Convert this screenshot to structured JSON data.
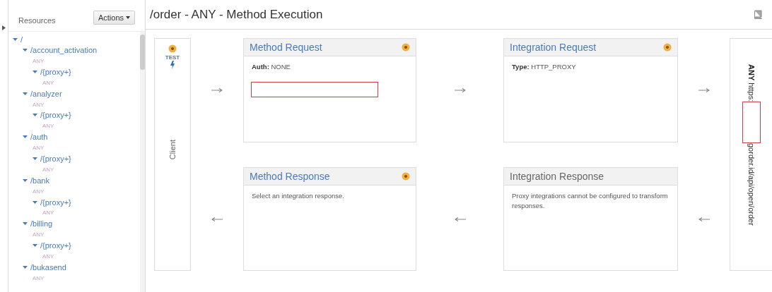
{
  "sidebar": {
    "title": "Resources",
    "actions_button": "Actions",
    "collapsed": false,
    "tree": [
      {
        "label": "/",
        "expanded": true,
        "children": [
          {
            "label": "/account_activation",
            "expanded": true,
            "methods": [
              "ANY"
            ],
            "children": [
              {
                "label": "/{proxy+}",
                "expanded": true,
                "methods": [
                  "ANY"
                ]
              }
            ]
          },
          {
            "label": "/analyzer",
            "expanded": true,
            "methods": [
              "ANY"
            ],
            "children": [
              {
                "label": "/{proxy+}",
                "expanded": true,
                "methods": [
                  "ANY"
                ]
              }
            ]
          },
          {
            "label": "/auth",
            "expanded": true,
            "methods": [
              "ANY"
            ],
            "children": [
              {
                "label": "/{proxy+}",
                "expanded": true,
                "methods": [
                  "ANY"
                ]
              }
            ]
          },
          {
            "label": "/bank",
            "expanded": true,
            "methods": [
              "ANY"
            ],
            "children": [
              {
                "label": "/{proxy+}",
                "expanded": true,
                "methods": [
                  "ANY"
                ]
              }
            ]
          },
          {
            "label": "/billing",
            "expanded": true,
            "methods": [
              "ANY"
            ],
            "children": [
              {
                "label": "/{proxy+}",
                "expanded": true,
                "methods": [
                  "ANY"
                ]
              }
            ]
          },
          {
            "label": "/bukasend",
            "expanded": true,
            "methods": [
              "ANY"
            ]
          }
        ]
      }
    ]
  },
  "main": {
    "title": "/order - ANY - Method Execution"
  },
  "client": {
    "test_label": "TEST",
    "label": "Client"
  },
  "cards": [
    {
      "title": "Method Request",
      "linked": true,
      "indicator": true,
      "redacted": true,
      "text": "**Auth:** NONE"
    },
    {
      "title": "Integration Request",
      "linked": true,
      "indicator": true,
      "redacted": false,
      "text": "**Type:** HTTP_PROXY"
    },
    {
      "title": "Method Response",
      "linked": true,
      "indicator": true,
      "redacted": false,
      "text": "Select an integration response."
    },
    {
      "title": "Integration Response",
      "linked": false,
      "indicator": false,
      "redacted": false,
      "text": "Proxy integrations cannot be configured to transform responses."
    }
  ],
  "endpoint": {
    "method": "ANY",
    "url_start": "https:",
    "url_end": "gorder.id/api/open/order",
    "redacted": true
  }
}
